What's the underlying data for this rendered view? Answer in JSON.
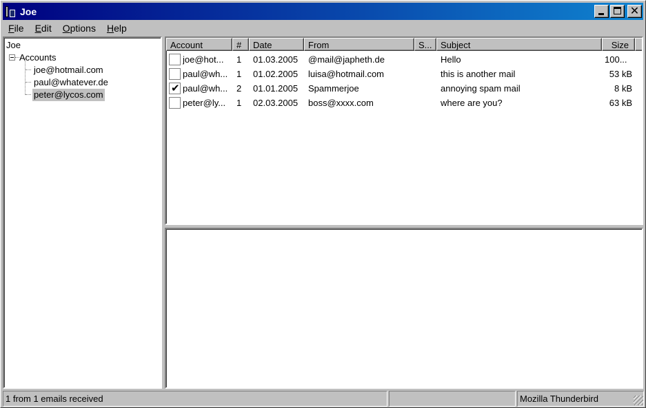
{
  "window": {
    "title": "Joe"
  },
  "menu": [
    {
      "key": "F",
      "rest": "ile"
    },
    {
      "key": "E",
      "rest": "dit"
    },
    {
      "key": "O",
      "rest": "ptions"
    },
    {
      "key": "H",
      "rest": "elp"
    }
  ],
  "tree": {
    "root": "Joe",
    "accounts_label": "Accounts",
    "children": [
      "joe@hotmail.com",
      "paul@whatever.de",
      "peter@lycos.com"
    ],
    "selected_index": 2
  },
  "columns": {
    "account": "Account",
    "num": "#",
    "date": "Date",
    "from": "From",
    "status": "S...",
    "subject": "Subject",
    "size": "Size"
  },
  "messages": [
    {
      "checked": false,
      "account": "joe@hot...",
      "num": "1",
      "date": "01.03.2005",
      "from": "@mail@japheth.de",
      "subject": "Hello",
      "size": "100..."
    },
    {
      "checked": false,
      "account": "paul@wh...",
      "num": "1",
      "date": "01.02.2005",
      "from": "luisa@hotmail.com",
      "subject": "this is another mail",
      "size": "53 kB"
    },
    {
      "checked": true,
      "account": "paul@wh...",
      "num": "2",
      "date": "01.01.2005",
      "from": "Spammerjoe",
      "subject": "annoying spam mail",
      "size": "8 kB"
    },
    {
      "checked": false,
      "account": "peter@ly...",
      "num": "1",
      "date": "02.03.2005",
      "from": "boss@xxxx.com",
      "subject": "where are you?",
      "size": "63 kB"
    }
  ],
  "statusbar": {
    "left": "1 from 1 emails received",
    "middle": "",
    "right": "Mozilla Thunderbird"
  }
}
